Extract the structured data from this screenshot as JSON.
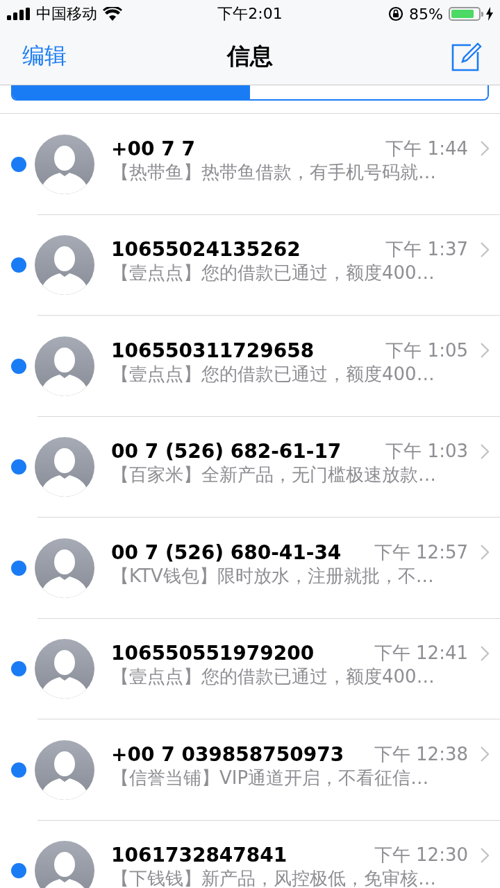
{
  "status_bar": {
    "carrier": "中国移动",
    "time": "下午2:01",
    "battery": "85%"
  },
  "nav": {
    "edit": "编辑",
    "title": "信息"
  },
  "tabs": [
    {
      "selected": true
    },
    {
      "selected": false
    }
  ],
  "messages": [
    {
      "sender": "+00 7 7",
      "time": "下午 1:44",
      "preview": "【热带鱼】热带鱼借款，有手机号码就…",
      "unread": true
    },
    {
      "sender": "10655024135262",
      "time": "下午 1:37",
      "preview": "【壹点点】您的借款已通过，额度400…",
      "unread": true
    },
    {
      "sender": "106550311729658",
      "time": "下午 1:05",
      "preview": "【壹点点】您的借款已通过，额度400…",
      "unread": true
    },
    {
      "sender": "00 7 (526) 682-61-17",
      "time": "下午 1:03",
      "preview": "【百家米】全新产品，无门槛极速放款…",
      "unread": true
    },
    {
      "sender": "00 7 (526) 680-41-34",
      "time": "下午 12:57",
      "preview": "【KTV钱包】限时放水，注册就批，不…",
      "unread": true
    },
    {
      "sender": "106550551979200",
      "time": "下午 12:41",
      "preview": "【壹点点】您的借款已通过，额度400…",
      "unread": true
    },
    {
      "sender": "+00 7 039858750973",
      "time": "下午 12:38",
      "preview": "【信誉当铺】VIP通道开启，不看征信…",
      "unread": true
    },
    {
      "sender": "1061732847841",
      "time": "下午 12:30",
      "preview": "【下钱钱】新产品，风控极低，免审核…",
      "unread": true
    }
  ]
}
